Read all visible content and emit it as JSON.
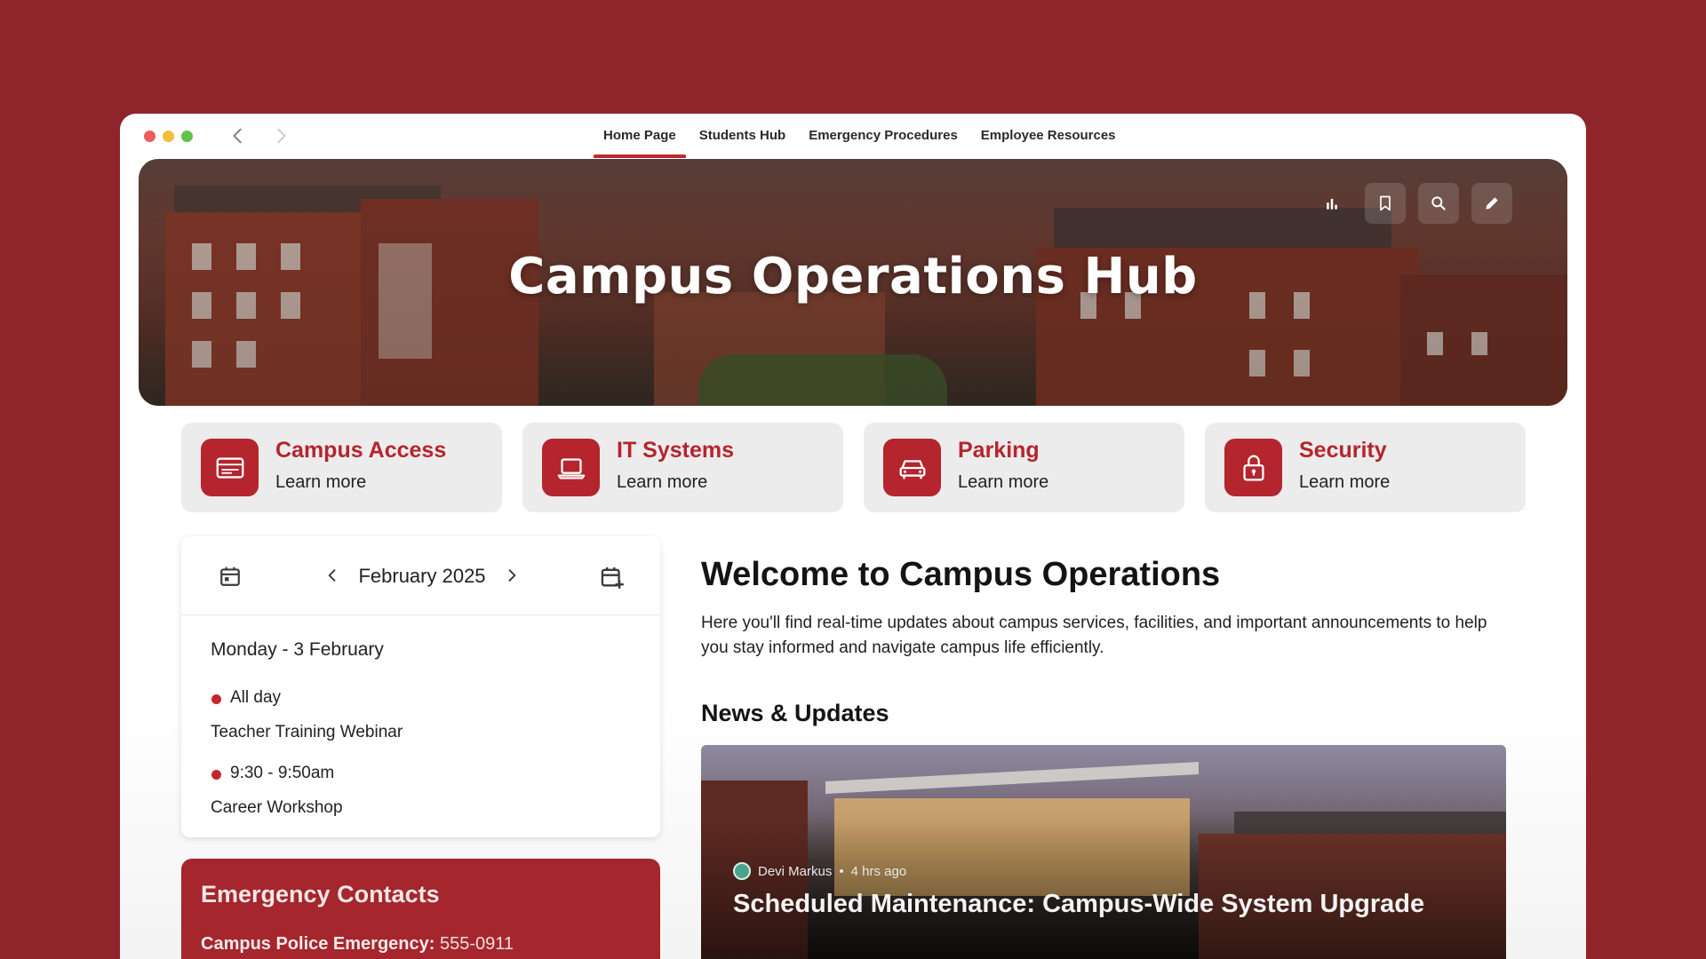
{
  "window": {
    "tabs": [
      {
        "label": "Home Page",
        "active": true
      },
      {
        "label": "Students Hub",
        "active": false
      },
      {
        "label": "Emergency Procedures",
        "active": false
      },
      {
        "label": "Employee Resources",
        "active": false
      }
    ]
  },
  "hero": {
    "title": "Campus Operations Hub",
    "tools": [
      "bar-chart-icon",
      "bookmark-icon",
      "search-icon",
      "pencil-icon"
    ]
  },
  "quick_links": [
    {
      "title": "Campus Access",
      "link": "Learn more",
      "icon": "id-card-icon"
    },
    {
      "title": "IT Systems",
      "link": "Learn more",
      "icon": "laptop-icon"
    },
    {
      "title": "Parking",
      "link": "Learn more",
      "icon": "car-icon"
    },
    {
      "title": "Security",
      "link": "Learn more",
      "icon": "lock-icon"
    }
  ],
  "calendar": {
    "month": "February 2025",
    "day_heading": "Monday - 3 February",
    "events": [
      {
        "time": "All day",
        "name": "Teacher Training Webinar"
      },
      {
        "time": "9:30 - 9:50am",
        "name": "Career Workshop"
      }
    ]
  },
  "emergency": {
    "title": "Emergency Contacts",
    "line_label": "Campus Police Emergency:",
    "line_value": "555-0911"
  },
  "main": {
    "welcome_title": "Welcome to Campus Operations",
    "intro": "Here you'll find real-time updates about campus services, facilities, and important announcements to help you stay informed and navigate campus life efficiently.",
    "news_heading": "News & Updates",
    "news": {
      "author": "Devi Markus",
      "time": "4 hrs ago",
      "title": "Scheduled Maintenance: Campus-Wide System Upgrade"
    }
  },
  "colors": {
    "brand": "#b5252d",
    "background": "#8f252b",
    "accent": "#c1272d"
  }
}
